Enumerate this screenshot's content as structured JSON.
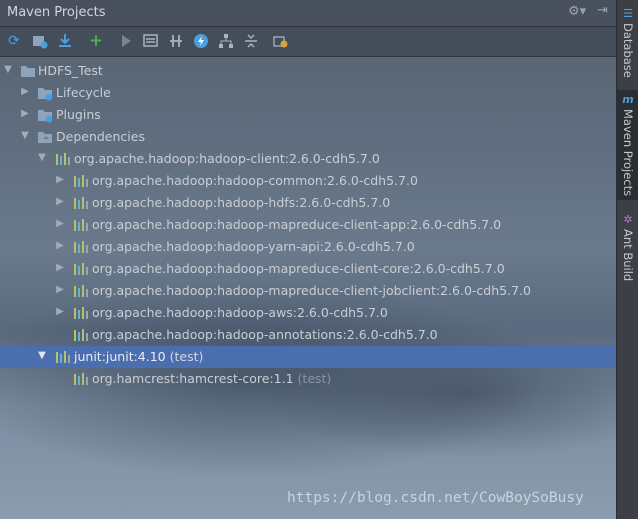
{
  "window": {
    "title": "Maven Projects"
  },
  "toolbar": {
    "buttons": [
      {
        "icon": "reimport-icon",
        "color": "#4a9fe0"
      },
      {
        "icon": "generate-sources-icon",
        "color": "#9fb3c8"
      },
      {
        "icon": "download-icon",
        "color": "#4a9fe0"
      },
      {
        "icon": "add-icon",
        "color": "#49b050"
      },
      {
        "icon": "run-icon",
        "color": "#7c838c"
      },
      {
        "icon": "toggle-offline-icon",
        "color": "#aab4c0"
      },
      {
        "icon": "skip-tests-icon",
        "color": "#aab4c0"
      },
      {
        "icon": "execute-goal-icon",
        "color": "#4a9fe0"
      },
      {
        "icon": "show-dependencies-icon",
        "color": "#aab4c0"
      },
      {
        "icon": "collapse-all-icon",
        "color": "#aab4c0"
      },
      {
        "icon": "settings-icon",
        "color": "#d9a33a"
      }
    ]
  },
  "tree": {
    "root": "HDFS_Test",
    "lifecycle": "Lifecycle",
    "plugins": "Plugins",
    "dependencies": "Dependencies",
    "hadoop_client": "org.apache.hadoop:hadoop-client:2.6.0-cdh5.7.0",
    "hadoop_children": [
      "org.apache.hadoop:hadoop-common:2.6.0-cdh5.7.0",
      "org.apache.hadoop:hadoop-hdfs:2.6.0-cdh5.7.0",
      "org.apache.hadoop:hadoop-mapreduce-client-app:2.6.0-cdh5.7.0",
      "org.apache.hadoop:hadoop-yarn-api:2.6.0-cdh5.7.0",
      "org.apache.hadoop:hadoop-mapreduce-client-core:2.6.0-cdh5.7.0",
      "org.apache.hadoop:hadoop-mapreduce-client-jobclient:2.6.0-cdh5.7.0",
      "org.apache.hadoop:hadoop-aws:2.6.0-cdh5.7.0",
      "org.apache.hadoop:hadoop-annotations:2.6.0-cdh5.7.0"
    ],
    "junit": {
      "name": "junit:junit:4.10",
      "scope": "(test)"
    },
    "hamcrest": {
      "name": "org.hamcrest:hamcrest-core:1.1",
      "scope": "(test)"
    }
  },
  "side_tabs": {
    "database": "Database",
    "maven": "Maven Projects",
    "ant": "Ant Build"
  },
  "watermark": "https://blog.csdn.net/CowBoySoBusy"
}
